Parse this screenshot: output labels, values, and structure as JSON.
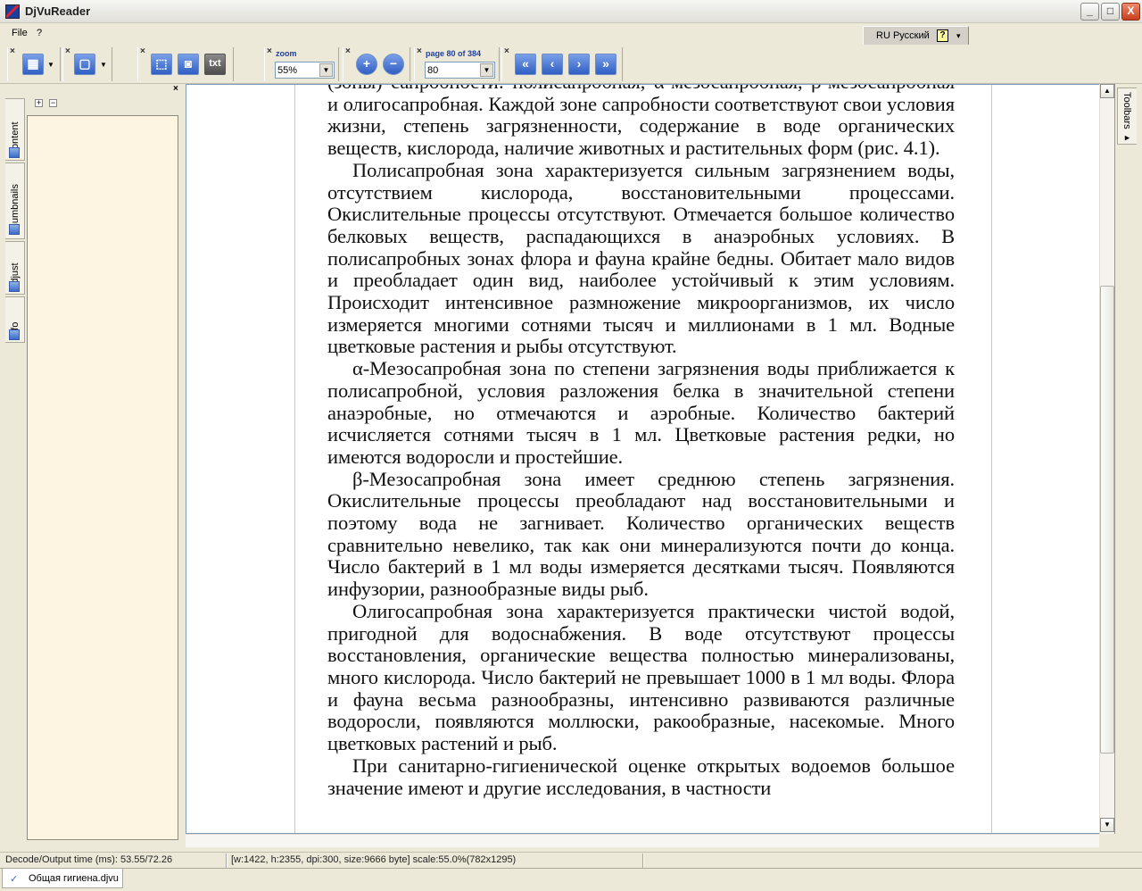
{
  "window": {
    "title": "DjVuReader",
    "minimize": "_",
    "maximize": "□",
    "close": "X"
  },
  "menu": {
    "file": "File",
    "help": "?"
  },
  "language": {
    "label": "RU Русский",
    "help": "?",
    "arrow": "▾"
  },
  "toolbar": {
    "zoom_label": "zoom",
    "zoom_value": "55%",
    "page_label": "page 80 of 384",
    "page_value": "80",
    "text_mode": "txt",
    "zoom_in": "+",
    "zoom_out": "−",
    "first": "«",
    "prev": "‹",
    "next": "›",
    "last": "»"
  },
  "sidebar": {
    "tabs": [
      "Content",
      "Thumbnails",
      "Adjust",
      "Info"
    ],
    "expand": "+",
    "collapse": "−",
    "close": "×"
  },
  "document": {
    "paragraphs": [
      {
        "indent": false,
        "text": "(зоны) сапробности: полисапробная, α-мезосапробная, β-мезосапробная и олигосапробная. Каждой зоне сапробности соответствуют свои условия жизни, степень загрязненности, содержание в воде органических веществ, кислорода, наличие животных и растительных форм (рис. 4.1)."
      },
      {
        "indent": true,
        "text": "Полисапробная зона характеризуется сильным загрязнением воды, отсутствием кислорода, восстановительными процессами. Окислительные процессы отсутствуют. Отмечается большое количество белковых веществ, распадающихся в анаэробных условиях. В полисапробных зонах флора и фауна крайне бедны. Обитает мало видов и преобладает один вид, наиболее устойчивый к этим условиям. Происходит интенсивное размножение микроорганизмов, их число измеряется многими сотнями тысяч и миллионами в 1 мл. Водные цветковые растения и рыбы отсутствуют."
      },
      {
        "indent": true,
        "text": "α-Мезосапробная зона по степени загрязнения воды приближается к полисапробной, условия разложения белка в значительной степени анаэробные, но отмечаются и аэробные. Количество бактерий исчисляется сотнями тысяч в 1 мл. Цветковые растения редки, но имеются водоросли и простейшие."
      },
      {
        "indent": true,
        "text": "β-Мезосапробная зона имеет среднюю степень загрязнения. Окислительные процессы преобладают над восстановительными и поэтому вода не загнивает. Количество органических веществ сравнительно невелико, так как они минерализуются почти до конца. Число бактерий в 1 мл воды измеряется десятками тысяч. Появляются инфузории, разнообразные виды рыб."
      },
      {
        "indent": true,
        "text": "Олигосапробная зона характеризуется практически чистой водой, пригодной для водоснабжения. В воде отсутствуют процессы восстановления, органические вещества полностью минерализованы, много кислорода. Число бактерий не превышает 1000 в 1 мл воды. Флора и фауна весьма разнообразны, интенсивно развиваются различные водоросли, появляются моллюски, ракообразные, насекомые. Много цветковых растений и рыб."
      },
      {
        "indent": true,
        "text": "При санитарно-гигиенической оценке открытых водоемов большое значение имеют и другие исследования, в частности"
      }
    ]
  },
  "right_panel": {
    "toolbars_label": "Toolbars ▸"
  },
  "status": {
    "decode_time": "Decode/Output time (ms): 53.55/72.26",
    "page_info": "[w:1422, h:2355, dpi:300, size:9666 byte] scale:55.0%(782x1295)"
  },
  "tabs": {
    "document_name": "Общая гигиена.djvu",
    "check": "✓"
  },
  "colors": {
    "accent": "#2f5fc3",
    "panel_bg": "#fdf5e2",
    "chrome": "#ece9d8"
  }
}
